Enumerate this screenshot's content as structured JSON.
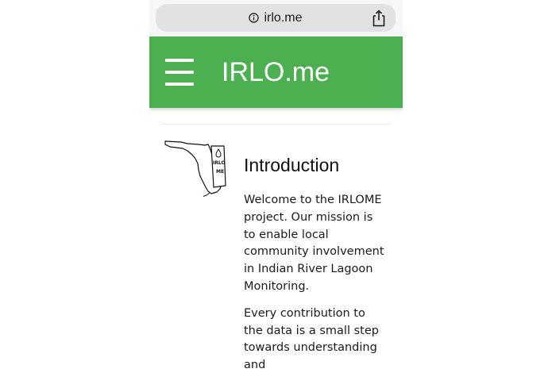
{
  "browser": {
    "url": "irlo.me",
    "info_icon": "info-circle-icon",
    "share_icon": "share-icon"
  },
  "header": {
    "menu_icon": "hamburger-menu-icon",
    "title": "IRLO.me",
    "background_color": "#4caf50"
  },
  "logo": {
    "label_line1": "IRLO",
    "label_line2": "ME"
  },
  "main": {
    "heading": "Introduction",
    "paragraphs": [
      "Welcome to the IRLOME project. Our mission is to enable local community involvement in Indian River Lagoon Monitoring.",
      "Every contribution to the data is a small step towards understanding and"
    ]
  }
}
